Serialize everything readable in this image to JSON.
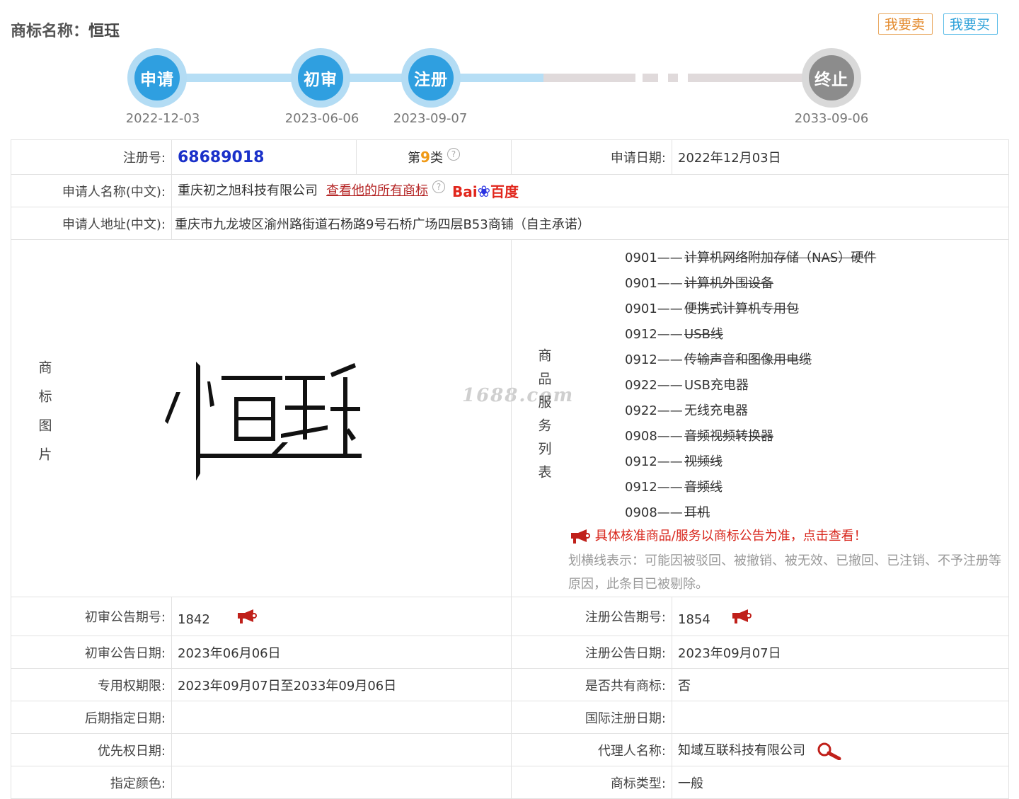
{
  "header": {
    "title_label": "商标名称：",
    "title_value": "恒珏",
    "sell_button": "我要卖",
    "buy_button": "我要买"
  },
  "timeline": [
    {
      "label": "申请",
      "date": "2022-12-03",
      "state": "done"
    },
    {
      "label": "初审",
      "date": "2023-06-06",
      "state": "done"
    },
    {
      "label": "注册",
      "date": "2023-09-07",
      "state": "done"
    },
    {
      "label": "终止",
      "date": "2033-09-06",
      "state": "future"
    }
  ],
  "info": {
    "reg_no_label": "注册号:",
    "reg_no": "68689018",
    "class_prefix": "第",
    "class_num": "9",
    "class_suffix": "类",
    "apply_date_label": "申请日期:",
    "apply_date": "2022年12月03日",
    "applicant_label": "申请人名称(中文):",
    "applicant": "重庆初之旭科技有限公司",
    "view_all_link": "查看他的所有商标",
    "baidu_text_1": "Bai",
    "baidu_text_2": "百度",
    "address_label": "申请人地址(中文):",
    "address": "重庆市九龙坡区渝州路街道石杨路9号石桥广场四层B53商铺（自主承诺）",
    "image_label": "商标图片",
    "goods_label": "商品服务列表",
    "watermark": "1688.com"
  },
  "goods": [
    {
      "code": "0901——",
      "name": "计算机网络附加存储（NAS）硬件",
      "struck": true
    },
    {
      "code": "0901——",
      "name": "计算机外围设备",
      "struck": true
    },
    {
      "code": "0901——",
      "name": "便携式计算机专用包",
      "struck": true
    },
    {
      "code": "0912——",
      "name": "USB线",
      "struck": true
    },
    {
      "code": "0912——",
      "name": "传输声音和图像用电缆",
      "struck": true
    },
    {
      "code": "0922——",
      "name": "USB充电器",
      "struck": false
    },
    {
      "code": "0922——",
      "name": "无线充电器",
      "struck": false
    },
    {
      "code": "0908——",
      "name": "音频视频转换器",
      "struck": true
    },
    {
      "code": "0912——",
      "name": "视频线",
      "struck": true
    },
    {
      "code": "0912——",
      "name": "音频线",
      "struck": true
    },
    {
      "code": "0908——",
      "name": "耳机",
      "struck": true
    }
  ],
  "goods_notice": "具体核准商品/服务以商标公告为准，点击查看！",
  "goods_note": "划横线表示：可能因被驳回、被撤销、被无效、已撤回、已注销、不予注册等原因，此条目已被剔除。",
  "details": {
    "prelim_no_label": "初审公告期号:",
    "prelim_no": "1842",
    "reg_notice_no_label": "注册公告期号:",
    "reg_notice_no": "1854",
    "prelim_date_label": "初审公告日期:",
    "prelim_date": "2023年06月06日",
    "reg_notice_date_label": "注册公告日期:",
    "reg_notice_date": "2023年09月07日",
    "exclusive_label": "专用权期限:",
    "exclusive": "2023年09月07日至2033年09月06日",
    "shared_label": "是否共有商标:",
    "shared": "否",
    "later_date_label": "后期指定日期:",
    "later_date": "",
    "intl_date_label": "国际注册日期:",
    "intl_date": "",
    "priority_label": "优先权日期:",
    "priority": "",
    "agent_label": "代理人名称:",
    "agent": "知域互联科技有限公司",
    "color_label": "指定颜色:",
    "color": "",
    "type_label": "商标类型:",
    "type": "一般"
  }
}
